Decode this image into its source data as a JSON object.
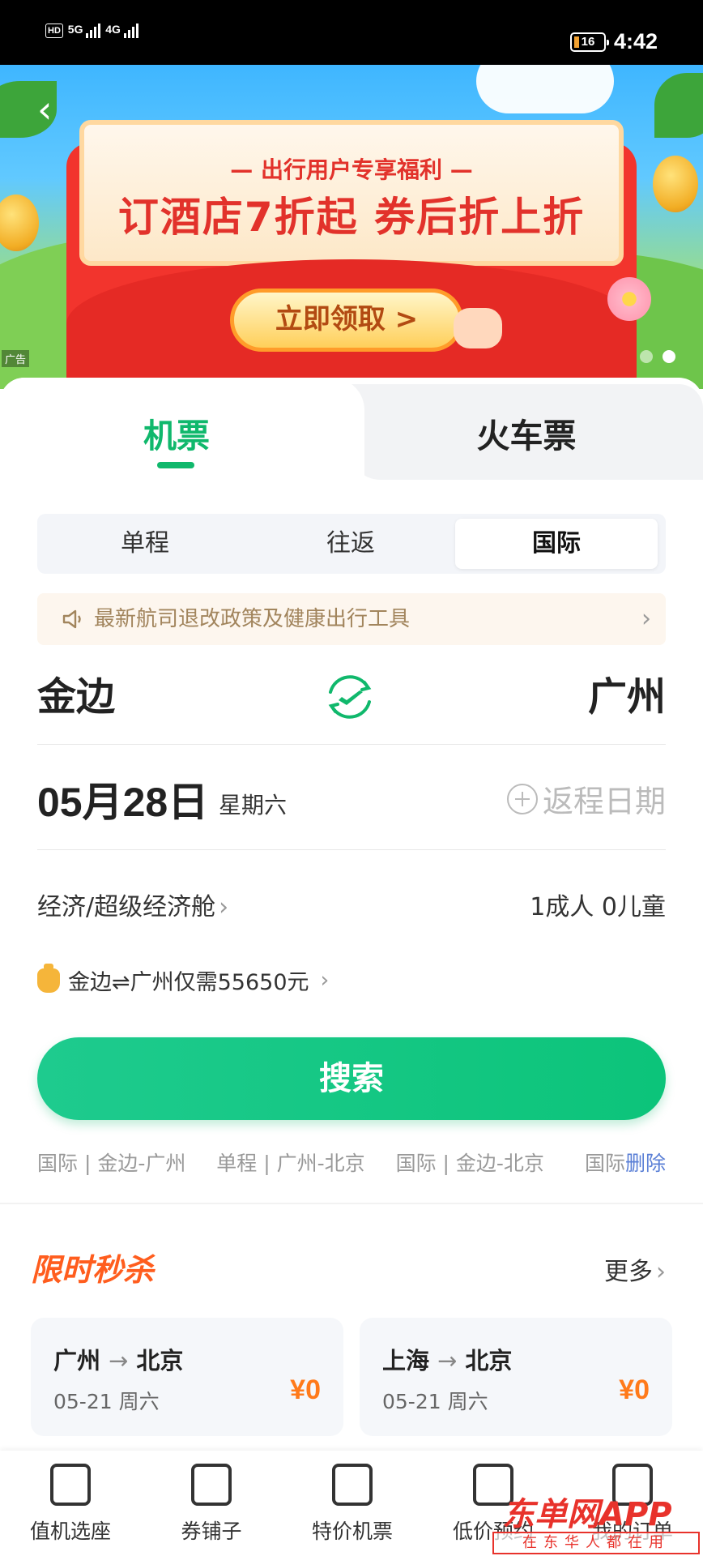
{
  "status_bar": {
    "signal_labels": [
      "HD",
      "5G",
      "4G"
    ],
    "battery_level": "16",
    "time": "4:42"
  },
  "banner": {
    "subtitle": "— 出行用户专享福利 —",
    "headline": "订酒店7折起 券后折上折",
    "button_label": "立即领取 >",
    "ad_tag": "广告",
    "page_count": 2,
    "active_page": 2
  },
  "tabs": [
    {
      "label": "机票",
      "active": true
    },
    {
      "label": "火车票",
      "active": false
    }
  ],
  "trip_types": [
    {
      "label": "单程",
      "active": false
    },
    {
      "label": "往返",
      "active": false
    },
    {
      "label": "国际",
      "active": true
    }
  ],
  "notice": {
    "text": "最新航司退改政策及健康出行工具",
    "icon": "speaker-icon"
  },
  "route": {
    "from_city": "金边",
    "to_city": "广州",
    "swap_icon": "swap-plane-icon"
  },
  "date": {
    "depart_date": "05月28日",
    "weekday": "星期六",
    "return_placeholder": "返程日期"
  },
  "cabin": {
    "class_label": "经济/超级经济舱",
    "passengers": "1成人 0儿童"
  },
  "price_tip": {
    "text": "金边⇌广州仅需55650元"
  },
  "search_button": {
    "label": "搜索"
  },
  "history": {
    "items": [
      "国际 | 金边-广州",
      "单程 | 广州-北京",
      "国际 | 金边-北京",
      "国际"
    ],
    "delete_label": "删除"
  },
  "flash_sale": {
    "title": "限时秒杀",
    "more_label": "更多",
    "deals": [
      {
        "from": "广州",
        "to": "北京",
        "date": "05-21 周六",
        "price": "¥0"
      },
      {
        "from": "上海",
        "to": "北京",
        "date": "05-21 周六",
        "price": "¥0"
      }
    ]
  },
  "bottom_nav": [
    {
      "label": "值机选座",
      "icon": "checkin-seat-icon"
    },
    {
      "label": "券铺子",
      "icon": "coupon-shop-icon"
    },
    {
      "label": "特价机票",
      "icon": "special-ticket-icon"
    },
    {
      "label": "低价预约",
      "icon": "price-reserve-icon"
    },
    {
      "label": "我的订单",
      "icon": "my-orders-icon"
    }
  ],
  "watermark": {
    "main": "东单网APP",
    "sub": "在东华人都在用"
  },
  "colors": {
    "brand_green": "#10b86c",
    "accent_orange": "#ff7a1a",
    "flash_red": "#ff5d1e",
    "link_blue": "#5a7fd6"
  }
}
